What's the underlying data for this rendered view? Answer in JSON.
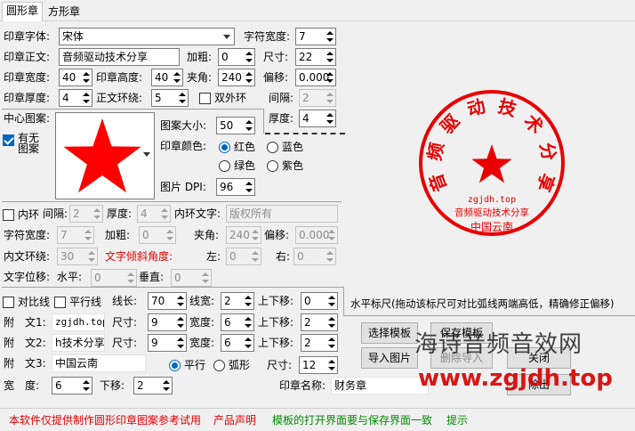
{
  "tabs": {
    "round": "圆形章",
    "square": "方形章"
  },
  "font": {
    "label": "印章字体:",
    "value": "宋体"
  },
  "char_width": {
    "label": "字符宽度:",
    "value": "7"
  },
  "seal_text": {
    "label": "印章正文:",
    "value": "音频驱动技术分享"
  },
  "bold": {
    "label": "加粗:",
    "value": "0"
  },
  "size": {
    "label": "尺寸:",
    "value": "22"
  },
  "seal_width": {
    "label": "印章宽度:",
    "value": "40"
  },
  "seal_height": {
    "label": "印章高度:",
    "value": "40"
  },
  "angle": {
    "label": "夹角:",
    "value": "240"
  },
  "offset": {
    "label": "偏移:",
    "value": "0.000"
  },
  "seal_thickness": {
    "label": "印章厚度:",
    "value": "4"
  },
  "text_ring": {
    "label": "正文环绕:",
    "value": "5"
  },
  "double_ring": {
    "label": "双外环"
  },
  "gap": {
    "label": "间隔:",
    "value": "2"
  },
  "center": {
    "label": "中心图案:",
    "has_none": "有无图案",
    "pattern_size_label": "图案大小:",
    "pattern_size": "50",
    "thickness_label": "厚度:",
    "thickness": "4",
    "star_color": "#ff0000"
  },
  "seal_color": {
    "label": "印章颜色:",
    "options": [
      "红色",
      "蓝色",
      "绿色",
      "紫色"
    ]
  },
  "dpi": {
    "label": "图片 DPI:",
    "value": "96"
  },
  "inner": {
    "label": "内环",
    "gap_label": "间隔:",
    "gap": "2",
    "thickness_label": "厚度:",
    "thickness": "4",
    "text_label": "内环文字:",
    "text": "版权所有"
  },
  "inner2": {
    "char_width_label": "字符宽度:",
    "char_width": "7",
    "bold_label": "加粗:",
    "bold": "0",
    "angle_label": "夹角:",
    "angle": "240",
    "offset_label": "偏移:",
    "offset": "0.000"
  },
  "inner3": {
    "ring_label": "内文环绕:",
    "ring": "30",
    "tilt_label": "文字倾斜角度:",
    "left_label": "左:",
    "left": "0",
    "right_label": "右:",
    "right": "0"
  },
  "shift": {
    "label": "文字位移:",
    "h_label": "水平:",
    "h": "0",
    "v_label": "垂直:",
    "v": "0"
  },
  "compare": {
    "label": "对比线",
    "parallel": "平行线",
    "len_label": "线长:",
    "len": "70",
    "lw_label": "线宽:",
    "lw": "2",
    "ud_label": "上下移:",
    "ud": "0"
  },
  "ruler": "水平标尺(拖动该标尺可对比弧线两端高低，精确修正偏移)",
  "sub1": {
    "label": "附　文1:",
    "value": "zgjdh.top",
    "size_label": "尺寸:",
    "size": "9",
    "w_label": "宽度:",
    "w": "6",
    "ud_label": "上下移:",
    "ud": "2"
  },
  "sub2": {
    "label": "附　文2:",
    "value": "h技术分享",
    "size_label": "尺寸:",
    "size": "9",
    "w_label": "宽度:",
    "w": "6",
    "ud_label": "上下移:",
    "ud": "2"
  },
  "sub3": {
    "label": "附　文3:",
    "value": "中国云南",
    "flat": "平行",
    "arc": "弧形",
    "size_label": "尺寸:",
    "size": "12"
  },
  "width_row": {
    "w_label": "宽　度:",
    "w": "6",
    "ud_label": "下移:",
    "ud": "2"
  },
  "seal_name": {
    "label": "印章名称:",
    "value": "财务章"
  },
  "buttons": {
    "select_template": "选择模板",
    "save_template": "保存模板",
    "import_image": "导入图片",
    "delete_import": "删除导入",
    "close": "关闭",
    "export_fragment": "除出"
  },
  "footer": {
    "notice": "本软件仅提供制作圆形印章图案参考试用",
    "statement": "产品声明",
    "hint": "模板的打开界面要与保存界面一致",
    "tip": "提示"
  },
  "preview": {
    "ring_text": "音频驱动技术分享",
    "sub1": "zgjdh.top",
    "sub2": "音频驱动技术分享",
    "sub3": "中国云南",
    "color": "#e80000"
  },
  "watermark": {
    "line1": "海诗音频音效网",
    "line2": "www.zgjdh.top"
  }
}
